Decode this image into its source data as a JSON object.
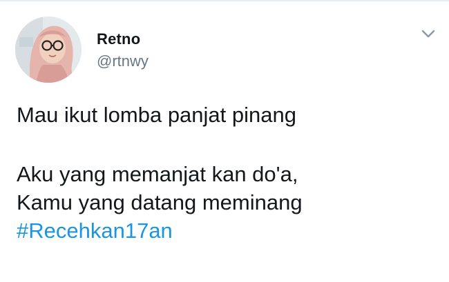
{
  "tweet": {
    "author": {
      "display_name": "Retno",
      "handle": "@rtnwy",
      "avatar_icon": "user-avatar-photo"
    },
    "menu_icon": "chevron-down-icon",
    "text_lines": [
      "Mau ikut lomba panjat pinang",
      "Aku yang memanjat kan do'a,",
      "Kamu yang datang meminang"
    ],
    "hashtag": "#Recehkan17an"
  },
  "colors": {
    "text": "#14171a",
    "secondary": "#657786",
    "link": "#1b95e0",
    "divider": "#e6ecf0"
  }
}
